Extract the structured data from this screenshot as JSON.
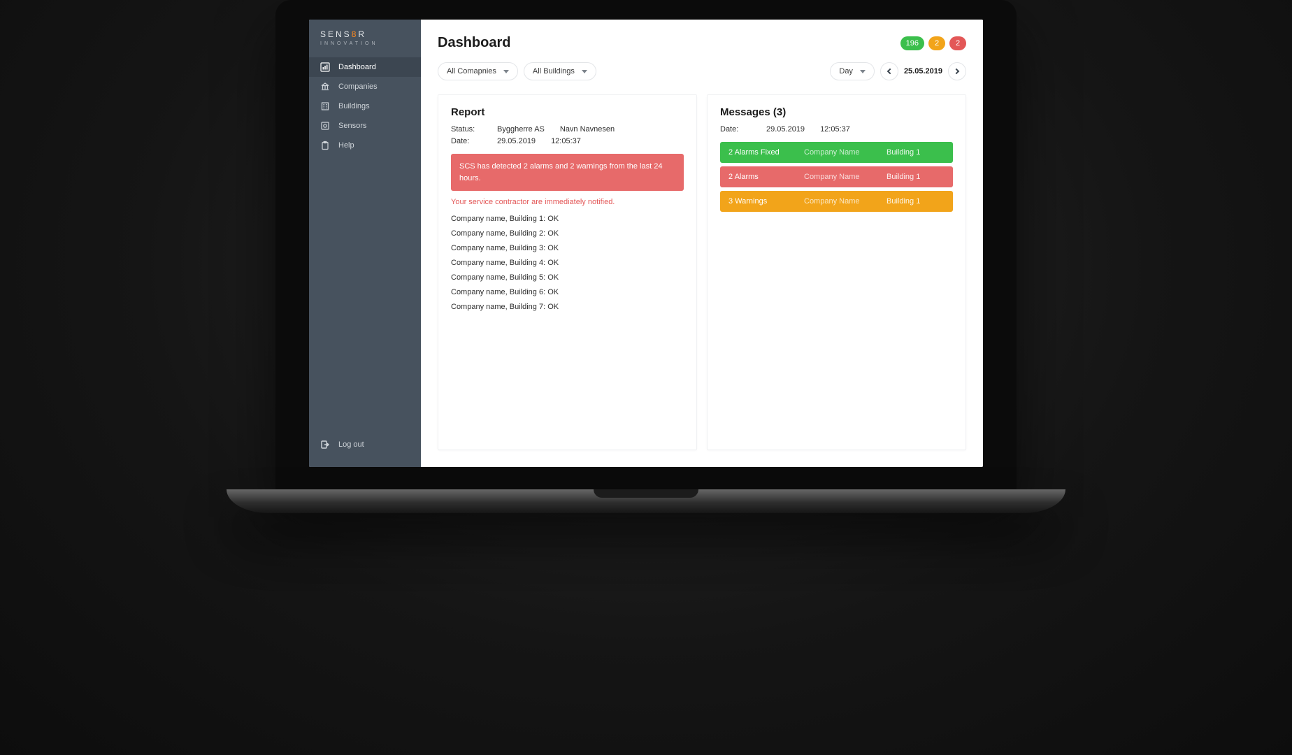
{
  "brand": {
    "prefix": "SENS",
    "accent": "8",
    "suffix": "R",
    "tagline": "INNOVATION"
  },
  "sidebar": {
    "items": [
      {
        "label": "Dashboard"
      },
      {
        "label": "Companies"
      },
      {
        "label": "Buildings"
      },
      {
        "label": "Sensors"
      },
      {
        "label": "Help"
      }
    ],
    "logout": "Log out"
  },
  "header": {
    "title": "Dashboard",
    "badges": {
      "green": "196",
      "orange": "2",
      "red": "2"
    }
  },
  "filters": {
    "companies": "All Comapnies",
    "buildings": "All Buildings",
    "range": "Day",
    "date": "25.05.2019"
  },
  "report": {
    "title": "Report",
    "status_label": "Status:",
    "status_v1": "Byggherre AS",
    "status_v2": "Navn Navnesen",
    "date_label": "Date:",
    "date_v1": "29.05.2019",
    "date_v2": "12:05:37",
    "alert": "SCS has detected 2 alarms and 2 warnings from the last 24 hours.",
    "service_line": "Your service contractor are immediately notified.",
    "items": [
      "Company name, Building 1: OK",
      "Company name, Building 2: OK",
      "Company name, Building 3: OK",
      "Company name, Building 4: OK",
      "Company name, Building 5: OK",
      "Company name, Building 6: OK",
      "Company name, Building 7: OK"
    ]
  },
  "messages": {
    "title": "Messages (3)",
    "date_label": "Date:",
    "date_v1": "29.05.2019",
    "date_v2": "12:05:37",
    "rows": [
      {
        "color": "green",
        "c1": "2 Alarms Fixed",
        "c2": "Company Name",
        "c3": "Building 1"
      },
      {
        "color": "red",
        "c1": "2 Alarms",
        "c2": "Company Name",
        "c3": "Building 1"
      },
      {
        "color": "orange",
        "c1": "3 Warnings",
        "c2": "Company Name",
        "c3": "Building 1"
      }
    ]
  }
}
